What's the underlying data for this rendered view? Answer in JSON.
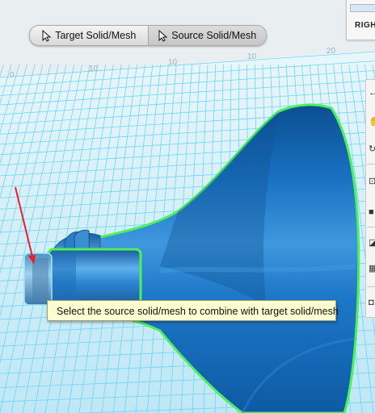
{
  "mode_toolbar": {
    "target_label": "Target Solid/Mesh",
    "source_label": "Source Solid/Mesh",
    "active": "source"
  },
  "view_cube": {
    "label": "RIGH"
  },
  "tooltip": {
    "text": "Select the source solid/mesh to combine with target solid/mesh"
  },
  "grid": {
    "labels": [
      "0",
      "10",
      "10",
      "10",
      "20"
    ]
  },
  "side_toolbar": {
    "tools": [
      "arrow-icon",
      "pan-hand-icon",
      "orbit-icon",
      "fit-view-icon",
      "solid-view-icon",
      "material-icon",
      "grid-snap-icon",
      "render-icon"
    ]
  },
  "colors": {
    "model": "#1f77c8",
    "selection_outline": "#4cf05a",
    "grid": "#62d3f6",
    "background": "#e9eef0",
    "tooltip_bg": "#feffd0",
    "arrow": "#e8202c"
  }
}
